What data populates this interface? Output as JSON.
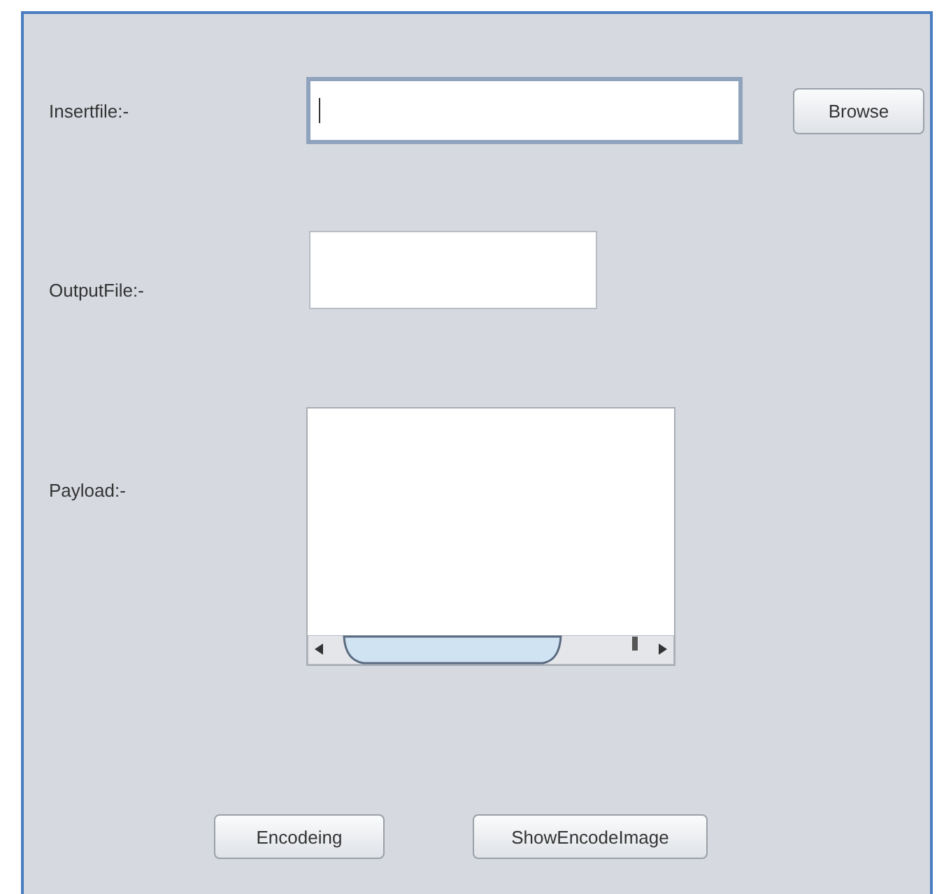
{
  "fields": [
    {
      "label": "Insertfile:-",
      "kind": "text",
      "focused": true,
      "button": "Browse"
    },
    {
      "label": "OutputFile:-",
      "kind": "text",
      "focused": false
    },
    {
      "label": "Payload:-",
      "kind": "textarea",
      "focused": false
    }
  ],
  "buttons": [
    "Encodeing",
    "ShowEncodeImage"
  ]
}
